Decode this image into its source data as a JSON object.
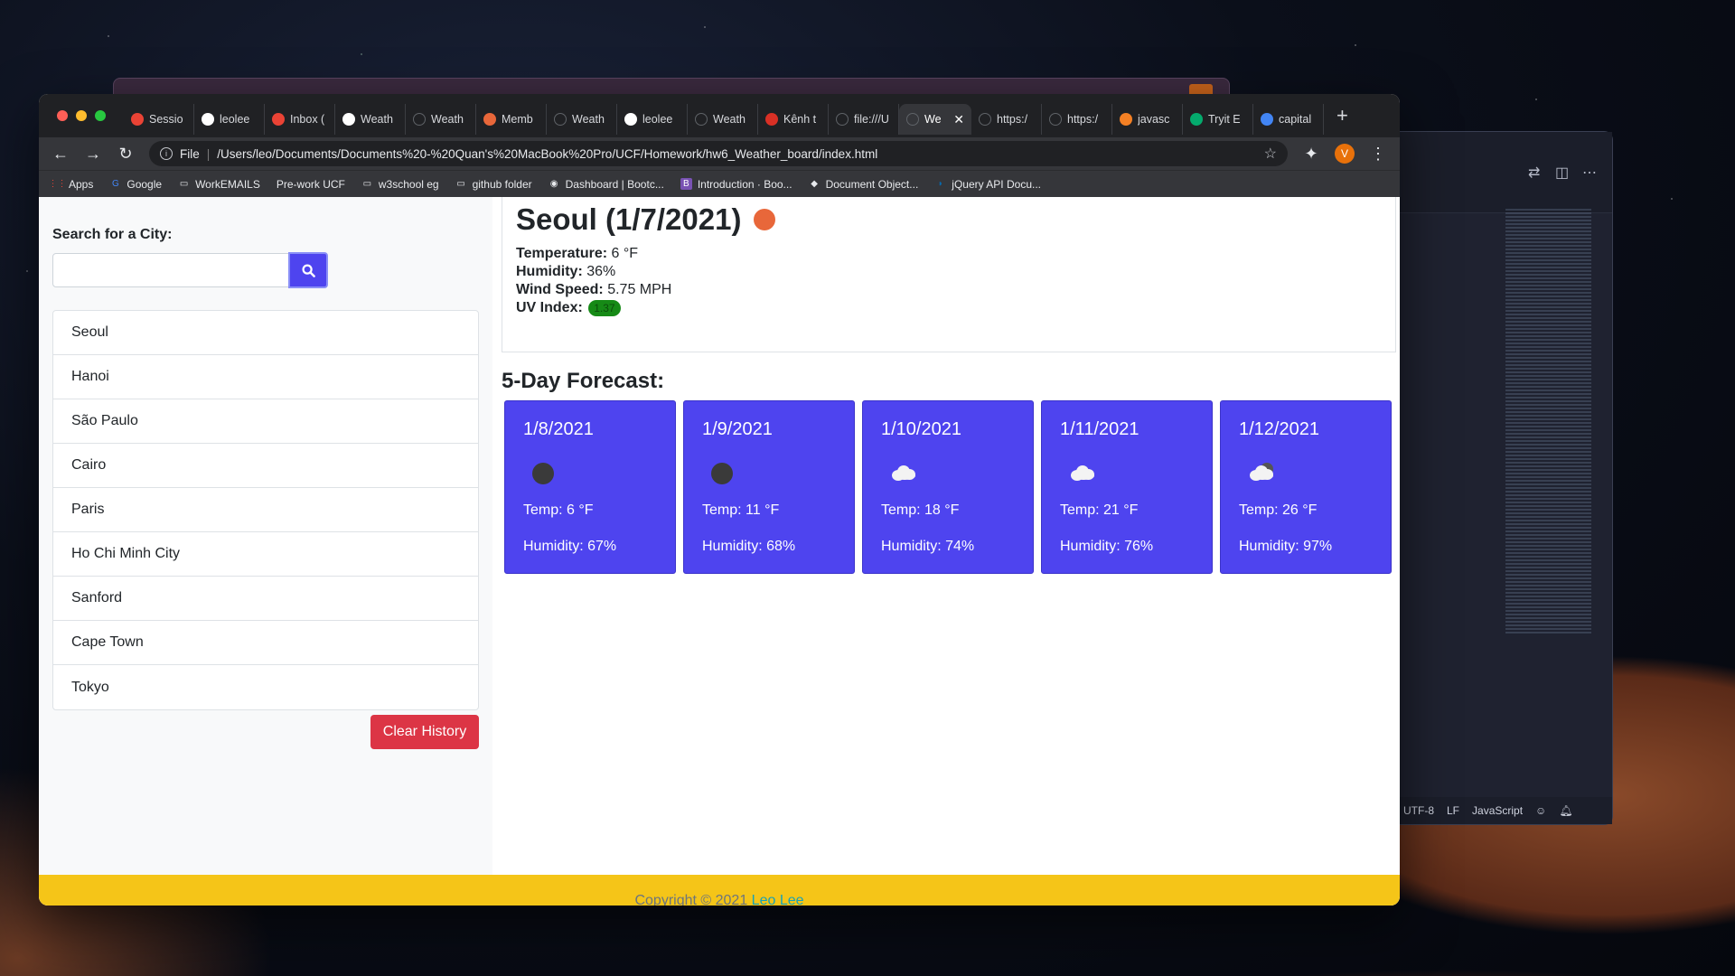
{
  "browser": {
    "tabs": [
      {
        "title": "Sessio",
        "favicon": "gmail-icon",
        "color": "#ea4335"
      },
      {
        "title": "leolee",
        "favicon": "github-icon",
        "color": "#ffffff"
      },
      {
        "title": "Inbox (",
        "favicon": "gmail-icon",
        "color": "#ea4335"
      },
      {
        "title": "Weath",
        "favicon": "github-icon",
        "color": "#ffffff"
      },
      {
        "title": "Weath",
        "favicon": "globe-icon",
        "color": "#5f6368"
      },
      {
        "title": "Memb",
        "favicon": "member-icon",
        "color": "#e8673a"
      },
      {
        "title": "Weath",
        "favicon": "globe-icon",
        "color": "#5f6368"
      },
      {
        "title": "leolee",
        "favicon": "github-icon",
        "color": "#ffffff"
      },
      {
        "title": "Weath",
        "favicon": "globe-icon",
        "color": "#5f6368"
      },
      {
        "title": "Kênh t",
        "favicon": "channel14-icon",
        "color": "#d93025"
      },
      {
        "title": "file:///U",
        "favicon": "globe-icon",
        "color": "#5f6368"
      },
      {
        "title": "We",
        "favicon": "globe-icon",
        "color": "#5f6368",
        "active": true
      },
      {
        "title": "https:/",
        "favicon": "globe-icon",
        "color": "#5f6368"
      },
      {
        "title": "https:/",
        "favicon": "globe-icon",
        "color": "#5f6368"
      },
      {
        "title": "javasc",
        "favicon": "stackoverflow-icon",
        "color": "#f48024"
      },
      {
        "title": "Tryit E",
        "favicon": "w3schools-icon",
        "color": "#04aa6d"
      },
      {
        "title": "capital",
        "favicon": "google-icon",
        "color": "#4285f4"
      }
    ],
    "new_tab": "+",
    "omnibox": {
      "scheme_label": "File",
      "url": "/Users/leo/Documents/Documents%20-%20Quan's%20MacBook%20Pro/UCF/Homework/hw6_Weather_board/index.html"
    },
    "profile_initial": "V",
    "bookmarks": [
      {
        "label": "Apps",
        "icon": "apps-grid-icon"
      },
      {
        "label": "Google",
        "icon": "google-icon"
      },
      {
        "label": "WorkEMAILS",
        "icon": "folder-icon"
      },
      {
        "label": "Pre-work UCF",
        "icon": ""
      },
      {
        "label": "w3school eg",
        "icon": "folder-icon"
      },
      {
        "label": "github folder",
        "icon": "folder-icon"
      },
      {
        "label": "Dashboard | Bootc...",
        "icon": "globe-icon"
      },
      {
        "label": "Introduction · Boo...",
        "icon": "bootstrap-icon"
      },
      {
        "label": "Document Object...",
        "icon": "dom-icon"
      },
      {
        "label": "jQuery API Docu...",
        "icon": "jquery-icon"
      }
    ]
  },
  "sidebar": {
    "search_label": "Search for a City:",
    "search_value": "",
    "cities": [
      "Seoul",
      "Hanoi",
      "São Paulo",
      "Cairo",
      "Paris",
      "Ho Chi Minh City",
      "Sanford",
      "Cape Town",
      "Tokyo"
    ],
    "clear_label": "Clear History"
  },
  "current": {
    "title": "Seoul (1/7/2021)",
    "temperature_label": "Temperature:",
    "temperature_value": "6 °F",
    "humidity_label": "Humidity:",
    "humidity_value": "36%",
    "wind_label": "Wind Speed:",
    "wind_value": "5.75 MPH",
    "uv_label": "UV Index:",
    "uv_value": "1.37",
    "uv_color": "#168a16"
  },
  "forecast": {
    "title": "5-Day Forecast:",
    "days": [
      {
        "date": "1/8/2021",
        "icon": "dark-circle-icon",
        "temp": "Temp: 6 °F",
        "humidity": "Humidity: 67%"
      },
      {
        "date": "1/9/2021",
        "icon": "dark-circle-icon",
        "temp": "Temp: 11 °F",
        "humidity": "Humidity: 68%"
      },
      {
        "date": "1/10/2021",
        "icon": "cloud-icon",
        "temp": "Temp: 18 °F",
        "humidity": "Humidity: 74%"
      },
      {
        "date": "1/11/2021",
        "icon": "cloud-icon",
        "temp": "Temp: 21 °F",
        "humidity": "Humidity: 76%"
      },
      {
        "date": "1/12/2021",
        "icon": "broken-clouds-icon",
        "temp": "Temp: 26 °F",
        "humidity": "Humidity: 97%"
      }
    ]
  },
  "footer": {
    "text": "Copyright © 2021 ",
    "link": "Leo Lee"
  },
  "editor": {
    "encoding": "UTF-8",
    "line_ending": "LF",
    "language": "JavaScript"
  },
  "colors": {
    "accent": "#4e44ef",
    "danger": "#dc3545",
    "footer": "#f5c518",
    "link": "#17a2b8"
  }
}
